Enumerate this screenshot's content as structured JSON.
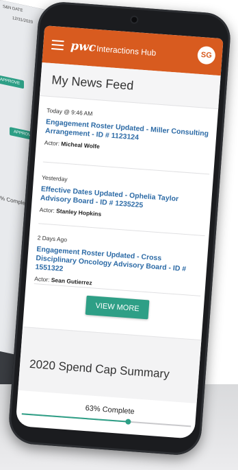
{
  "background": {
    "laptop_labels": [
      "S&N DATE",
      "12/31/2020",
      "APPROVE",
      "APPROVE",
      "% Complete"
    ]
  },
  "app": {
    "brand": "pwc",
    "title": "Interactions Hub",
    "avatar_initials": "SG",
    "accent_color": "#d85b1f",
    "button_color": "#2e9f86",
    "link_color": "#2d6ba6"
  },
  "news_feed": {
    "heading": "My News Feed",
    "items": [
      {
        "when": "Today @ 9:46 AM",
        "title": "Engagement Roster Updated - Miller Consulting Arrangement - ID # 1123124",
        "actor_label": "Actor:",
        "actor": "Micheal Wolfe"
      },
      {
        "when": "Yesterday",
        "title": "Effective Dates Updated - Ophelia Taylor Advisory Board - ID # 1235225",
        "actor_label": "Actor:",
        "actor": "Stanley Hopkins"
      },
      {
        "when": "2 Days Ago",
        "title": "Engagement Roster Updated - Cross Disciplinary Oncology Advisory Board - ID # 1551322",
        "actor_label": "Actor:",
        "actor": "Sean Gutierrez"
      }
    ],
    "view_more_label": "VIEW MORE"
  },
  "spend_cap": {
    "heading": "2020 Spend Cap Summary",
    "progress_label": "63% Complete",
    "progress_fraction": 0.63
  }
}
